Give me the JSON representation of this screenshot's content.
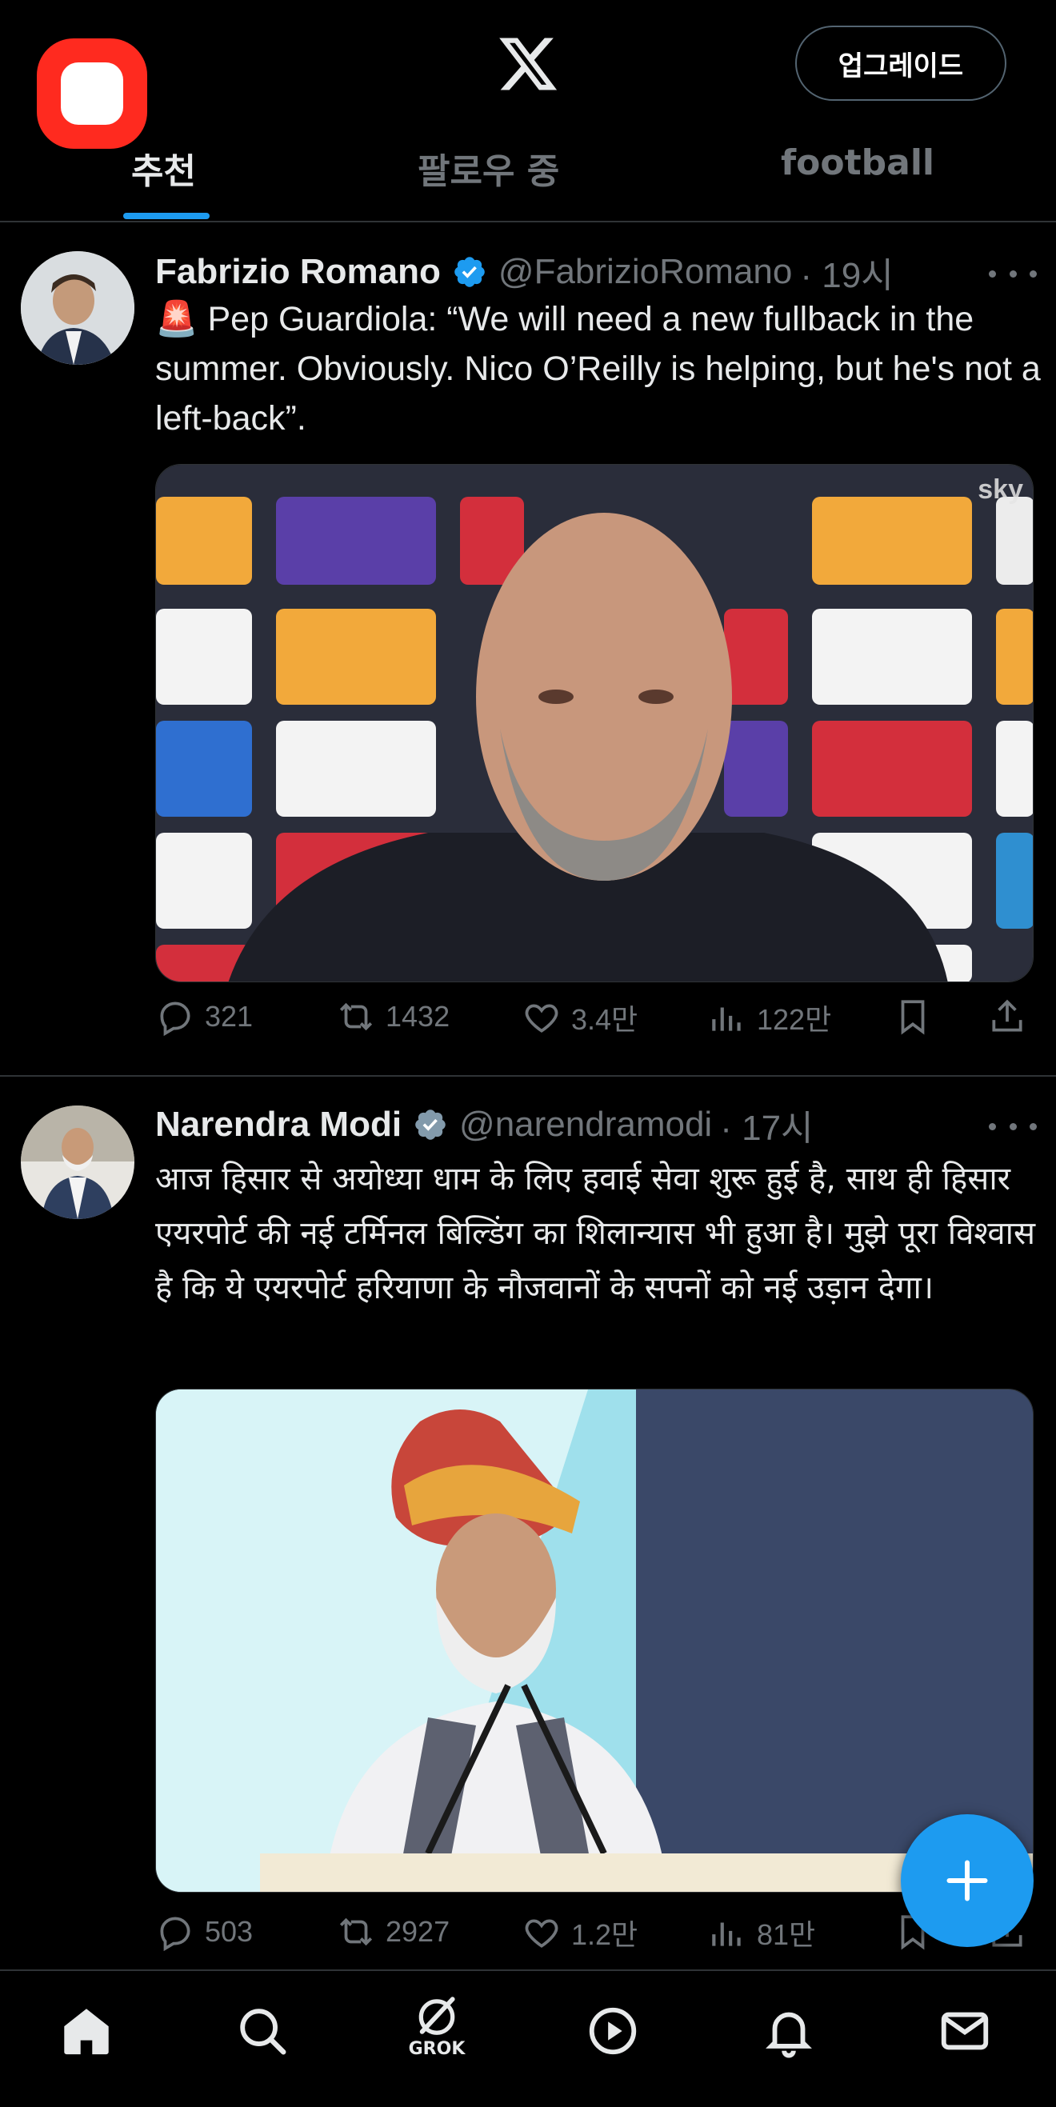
{
  "header": {
    "upgrade_label": "업그레이드",
    "tabs": [
      {
        "label": "추천",
        "active": true
      },
      {
        "label": "팔로우 중",
        "active": false
      },
      {
        "label": "football",
        "active": false
      }
    ]
  },
  "posts": [
    {
      "name": "Fabrizio Romano",
      "handle": "@FabrizioRomano",
      "time": "· 19시",
      "text_emoji": "🚨",
      "text": "Pep Guardiola: “We will need a new fullback in the summer. Obviously. Nico O’Reilly is helping, but he's not a left-back”.",
      "media_watermark": "sky",
      "stats": {
        "replies": "321",
        "reposts": "1432",
        "likes": "3.4만",
        "views": "122만"
      }
    },
    {
      "name": "Narendra Modi",
      "handle": "@narendramodi",
      "time": "· 17시",
      "text": "आज हिसार से अयोध्या धाम के लिए हवाई सेवा शुरू हुई है, साथ ही हिसार एयरपोर्ट की नई टर्मिनल बिल्डिंग का शिलान्यास भी हुआ है। मुझे पूरा विश्वास है कि ये एयरपोर्ट हरियाणा के नौजवानों के सपनों को नई उड़ान देगा।",
      "stats": {
        "replies": "503",
        "reposts": "2927",
        "likes": "1.2만",
        "views": "81만"
      }
    }
  ],
  "bottom_nav": {
    "grok_label": "GROK"
  },
  "colors": {
    "accent": "#1d9bf0",
    "muted": "#71767b",
    "text": "#e7e9ea",
    "background": "#000000",
    "recording": "#ff2a1f"
  }
}
